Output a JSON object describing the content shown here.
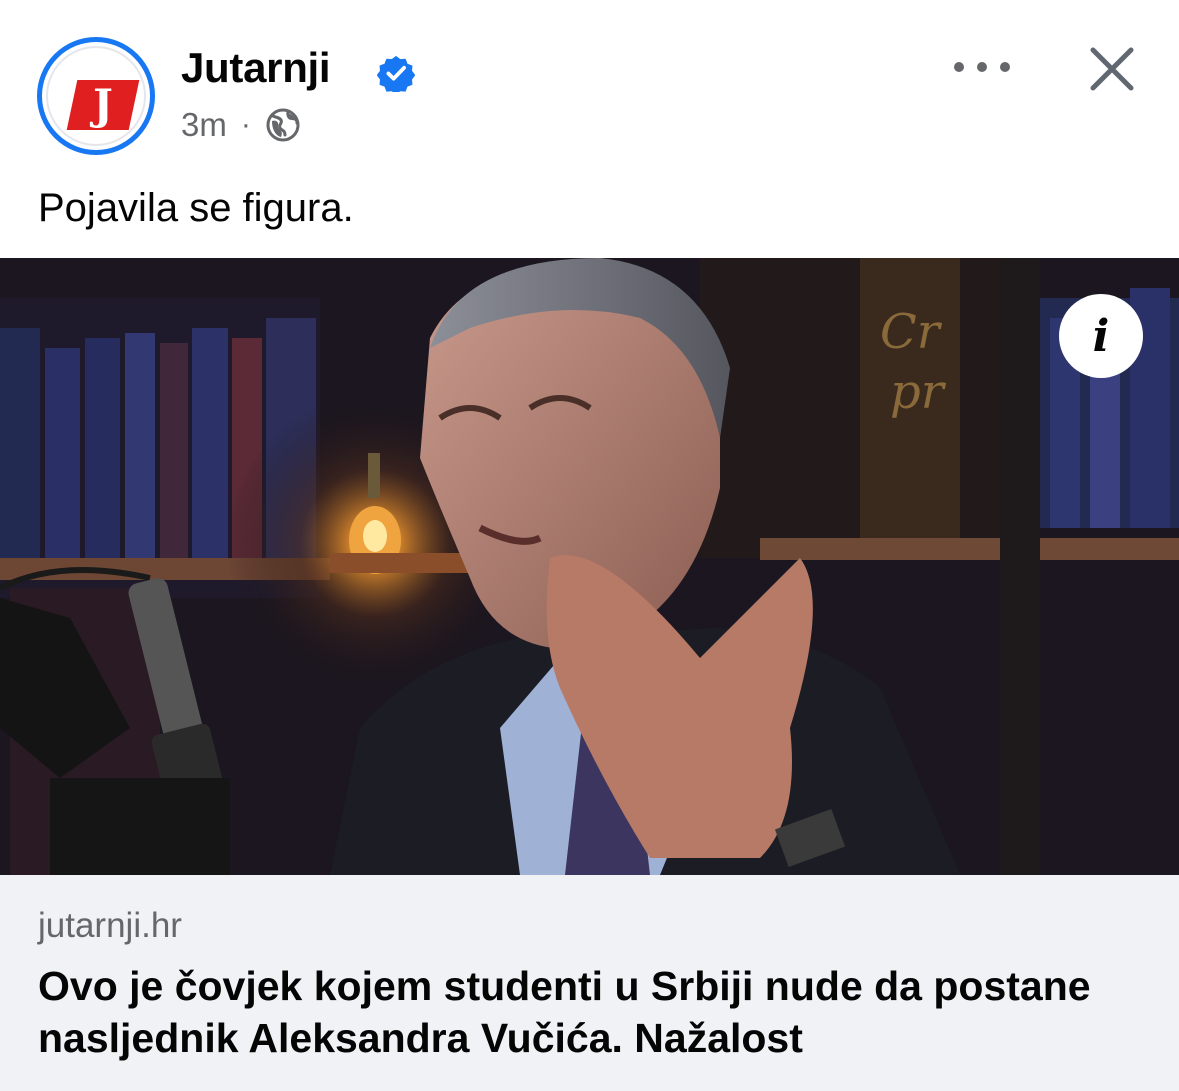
{
  "post": {
    "page_name": "Jutarnji",
    "logo_letter": "J",
    "time": "3m",
    "separator": "·",
    "audience_icon": "globe-icon",
    "text": "Pojavila se figura."
  },
  "link_preview": {
    "domain": "jutarnji.hr",
    "headline": "Ovo je čovjek kojem studenti u Srbiji nude da postane nasljednik Aleksandra Vučića. Nažalost",
    "info_label": "i"
  },
  "colors": {
    "accent": "#1877f2",
    "logo_red": "#e02020",
    "secondary_text": "#65676b",
    "link_bg": "#f0f2f5"
  }
}
